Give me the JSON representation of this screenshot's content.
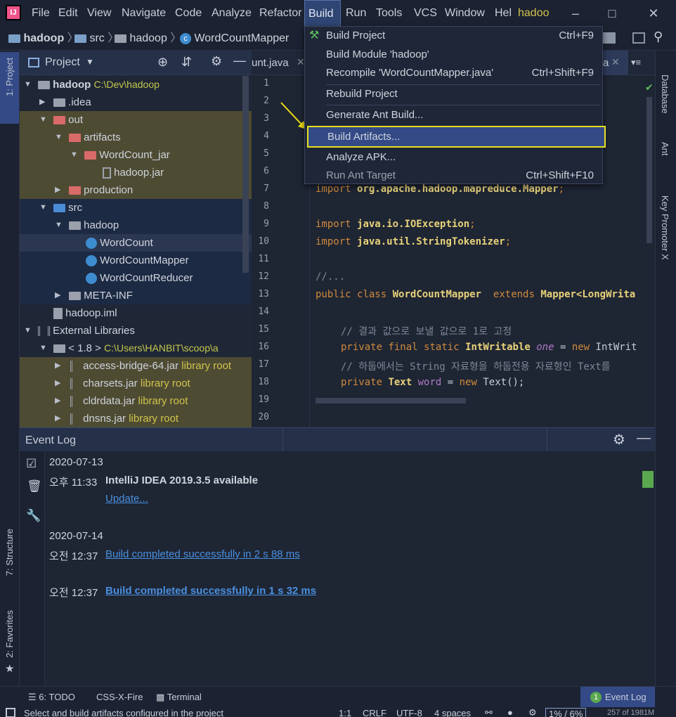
{
  "menubar": {
    "items": [
      "File",
      "Edit",
      "View",
      "Navigate",
      "Code",
      "Analyze",
      "Refactor",
      "Build",
      "Run",
      "Tools",
      "VCS",
      "Window",
      "Hel"
    ],
    "project_name": "hadoo"
  },
  "navbar": {
    "crumbs": [
      "hadoop",
      "src",
      "hadoop",
      "WordCountMapper"
    ]
  },
  "project_panel": {
    "title": "Project",
    "tree": [
      {
        "label": "hadoop",
        "extra": "C:\\Dev\\hadoop"
      },
      {
        "label": ".idea"
      },
      {
        "label": "out"
      },
      {
        "label": "artifacts"
      },
      {
        "label": "WordCount_jar"
      },
      {
        "label": "hadoop.jar"
      },
      {
        "label": "production"
      },
      {
        "label": "src"
      },
      {
        "label": "hadoop"
      },
      {
        "label": "WordCount"
      },
      {
        "label": "WordCountMapper"
      },
      {
        "label": "WordCountReducer"
      },
      {
        "label": "META-INF"
      },
      {
        "label": "hadoop.iml"
      },
      {
        "label": "External Libraries"
      },
      {
        "label": "< 1.8 >",
        "extra": "C:\\Users\\HANBIT\\scoop\\a"
      },
      {
        "label": "access-bridge-64.jar",
        "extra": "library root"
      },
      {
        "label": "charsets.jar",
        "extra": "library root"
      },
      {
        "label": "cldrdata.jar",
        "extra": "library root"
      },
      {
        "label": "dnsns.jar",
        "extra": "library root"
      }
    ]
  },
  "editor": {
    "tab_left": "unt.java",
    "tab_right": "a",
    "line_numbers": [
      "1",
      "2",
      "3",
      "4",
      "5",
      "6",
      "7",
      "8",
      "9",
      "10",
      "11",
      "12",
      "13",
      "14",
      "15",
      "16",
      "17",
      "18",
      "19",
      "20"
    ],
    "code": {
      "l7": "org.apache.hadoop.mapreduce.Mapper",
      "l9": "java.io.IOException",
      "l10": "java.util.StringTokenizer",
      "l12": "//...",
      "l13_class": "WordCountMapper",
      "l13_ext": "Mapper<LongWrita",
      "l16": "// 결과 값으로 보낼 값으로 1로 고정",
      "l17_type": "IntWritable",
      "l17_var": "one",
      "l17_rest": "IntWrit",
      "l18": "// 하둡에서는 String 자료형을 하둡전용 자료형인 Text를",
      "l19_type": "Text",
      "l19_var": "word",
      "l19_rest": "Text();",
      "kw_import": "import",
      "kw_public": "public",
      "kw_class": "class",
      "kw_extends": "extends",
      "kw_private": "private",
      "kw_final": "final",
      "kw_static": "static",
      "kw_new": "new",
      "semi": ";",
      "eq": " = "
    }
  },
  "build_menu": {
    "items": [
      {
        "label": "Build Project",
        "shortcut": "Ctrl+F9"
      },
      {
        "label": "Build Module 'hadoop'",
        "shortcut": ""
      },
      {
        "label": "Recompile 'WordCountMapper.java'",
        "shortcut": "Ctrl+Shift+F9"
      },
      {
        "label": "Rebuild Project",
        "shortcut": ""
      },
      {
        "label": "Generate Ant Build...",
        "shortcut": ""
      },
      {
        "label": "Build Artifacts...",
        "shortcut": ""
      },
      {
        "label": "Analyze APK...",
        "shortcut": ""
      },
      {
        "label": "Run Ant Target",
        "shortcut": "Ctrl+Shift+F10"
      }
    ]
  },
  "event_log": {
    "title": "Event Log",
    "entries": [
      {
        "date": "2020-07-13",
        "time": "오후 11:33",
        "message": "IntelliJ IDEA 2019.3.5 available",
        "link": "Update..."
      },
      {
        "date": "2020-07-14",
        "time": "오전 12:37",
        "link": "Build completed successfully in 2 s 88 ms"
      },
      {
        "time": "오전 12:37",
        "link": "Build completed successfully in 1 s 32 ms"
      }
    ]
  },
  "side_tabs": {
    "left": [
      "1: Project",
      "7: Structure",
      "2: Favorites"
    ],
    "right": [
      "Database",
      "Ant",
      "Key Promoter X"
    ]
  },
  "bottom_tabs": {
    "todo": "6: TODO",
    "cssx": "CSS-X-Fire",
    "terminal": "Terminal",
    "eventlog": "Event Log",
    "eventlog_count": "1"
  },
  "statusbar": {
    "message": "Select and build artifacts configured in the project",
    "position": "1:1",
    "line_sep": "CRLF",
    "encoding": "UTF-8",
    "indent": "4 spaces",
    "mem1": "1%",
    "mem2": "6%",
    "heap": "257 of 1981M"
  },
  "colors": {
    "accent": "#344a87",
    "highlight_border": "#e6e01f",
    "arrow": "#f0e014"
  }
}
